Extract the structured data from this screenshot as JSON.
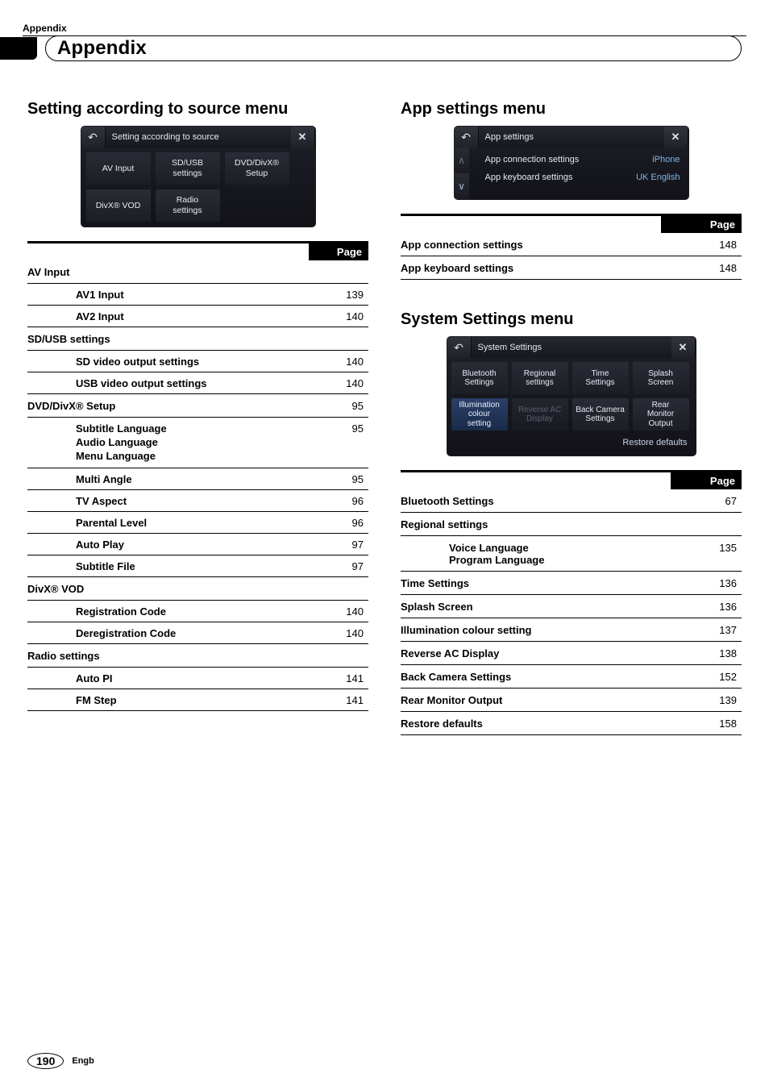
{
  "running_header": "Appendix",
  "chapter_title": "Appendix",
  "left": {
    "section_title": "Setting according to source menu",
    "panel": {
      "title": "Setting according to source",
      "tiles": [
        "AV Input",
        "SD/USB settings",
        "DVD/DivX® Setup",
        "DivX® VOD",
        "Radio settings"
      ]
    },
    "page_header": "Page",
    "rows": [
      {
        "type": "cat",
        "label": "AV Input"
      },
      {
        "type": "sub",
        "label": "AV1 Input",
        "page": "139"
      },
      {
        "type": "sub",
        "label": "AV2 Input",
        "page": "140"
      },
      {
        "type": "cat",
        "label": "SD/USB settings"
      },
      {
        "type": "sub",
        "label": "SD video output settings",
        "page": "140"
      },
      {
        "type": "sub",
        "label": "USB video output settings",
        "page": "140"
      },
      {
        "type": "cat",
        "label": "DVD/DivX® Setup",
        "page": "95"
      },
      {
        "type": "sub",
        "label": "Subtitle Language\nAudio Language\nMenu Language",
        "page": "95"
      },
      {
        "type": "sub",
        "label": "Multi Angle",
        "page": "95"
      },
      {
        "type": "sub",
        "label": "TV Aspect",
        "page": "96"
      },
      {
        "type": "sub",
        "label": "Parental Level",
        "page": "96"
      },
      {
        "type": "sub",
        "label": "Auto Play",
        "page": "97"
      },
      {
        "type": "sub",
        "label": "Subtitle File",
        "page": "97"
      },
      {
        "type": "cat",
        "label": "DivX® VOD"
      },
      {
        "type": "sub",
        "label": "Registration Code",
        "page": "140"
      },
      {
        "type": "sub",
        "label": "Deregistration Code",
        "page": "140"
      },
      {
        "type": "cat",
        "label": "Radio settings"
      },
      {
        "type": "sub",
        "label": "Auto PI",
        "page": "141"
      },
      {
        "type": "sub",
        "label": "FM Step",
        "page": "141"
      }
    ]
  },
  "right_app": {
    "section_title": "App settings menu",
    "panel": {
      "title": "App settings",
      "rows": [
        {
          "l": "App connection settings",
          "r": "iPhone"
        },
        {
          "l": "App keyboard settings",
          "r": "UK English"
        }
      ]
    },
    "page_header": "Page",
    "rows": [
      {
        "label": "App connection settings",
        "page": "148"
      },
      {
        "label": "App keyboard settings",
        "page": "148"
      }
    ]
  },
  "right_sys": {
    "section_title": "System Settings menu",
    "panel": {
      "title": "System Settings",
      "tiles": [
        {
          "t": "Bluetooth Settings",
          "c": "sys-norm"
        },
        {
          "t": "Regional settings",
          "c": "sys-norm"
        },
        {
          "t": "Time Settings",
          "c": "sys-norm"
        },
        {
          "t": "Splash Screen",
          "c": "sys-norm"
        },
        {
          "t": "Illumination colour setting",
          "c": "sys-blue"
        },
        {
          "t": "Reverse AC Display",
          "c": "sys-dim"
        },
        {
          "t": "Back Camera Settings",
          "c": "sys-norm"
        },
        {
          "t": "Rear Monitor Output",
          "c": "sys-norm"
        }
      ],
      "restore": "Restore defaults"
    },
    "page_header": "Page",
    "rows": [
      {
        "type": "row",
        "label": "Bluetooth Settings",
        "page": "67"
      },
      {
        "type": "row",
        "label": "Regional settings"
      },
      {
        "type": "sub",
        "label": "Voice Language\nProgram Language",
        "page": "135"
      },
      {
        "type": "row",
        "label": "Time Settings",
        "page": "136"
      },
      {
        "type": "row",
        "label": "Splash Screen",
        "page": "136"
      },
      {
        "type": "row",
        "label": "Illumination colour setting",
        "page": "137"
      },
      {
        "type": "row",
        "label": "Reverse AC Display",
        "page": "138"
      },
      {
        "type": "row",
        "label": "Back Camera Settings",
        "page": "152"
      },
      {
        "type": "row",
        "label": "Rear Monitor Output",
        "page": "139"
      },
      {
        "type": "row",
        "label": "Restore defaults",
        "page": "158"
      }
    ]
  },
  "footer": {
    "page_number": "190",
    "lang": "Engb"
  },
  "icons": {
    "back": "↶",
    "close": "✕",
    "up": "∧",
    "down": "∨"
  }
}
